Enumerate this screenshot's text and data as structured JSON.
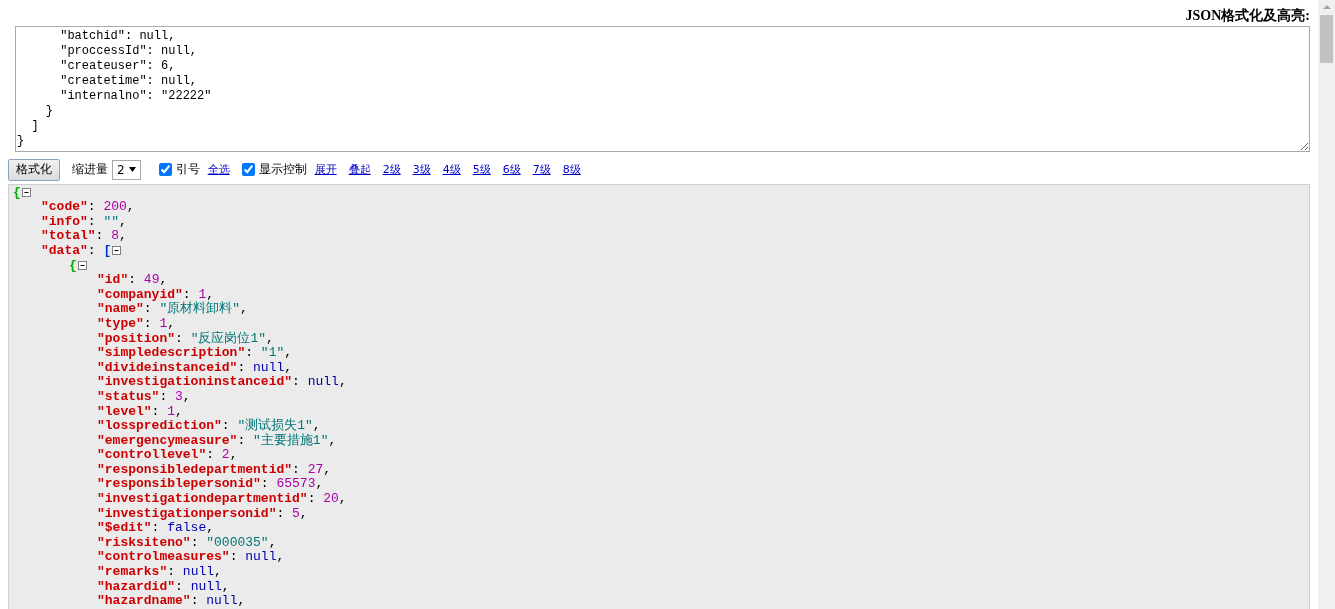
{
  "heading": "JSON格式化及高亮:",
  "input": {
    "lines": [
      "      \"batchid\": null,",
      "      \"proccessId\": null,",
      "      \"createuser\": 6,",
      "      \"createtime\": null,",
      "      \"internalno\": \"22222\"",
      "    }",
      "  ]",
      "}"
    ]
  },
  "toolbar": {
    "format_button": "格式化",
    "indent_label": "缩进量",
    "indent_value": "2",
    "quote": {
      "label": "引号",
      "checked": true
    },
    "select_all": "全选",
    "show_controls": {
      "label": "显示控制",
      "checked": true
    },
    "links": [
      "展开",
      "叠起",
      "2级",
      "3级",
      "4级",
      "5级",
      "6级",
      "7级",
      "8级"
    ]
  },
  "output": {
    "open": "{",
    "kind": "object",
    "expanded": true,
    "children": [
      {
        "key": "\"code\"",
        "sep": ": ",
        "value": "200",
        "kind": "number",
        "end": ","
      },
      {
        "key": "\"info\"",
        "sep": ": ",
        "value": "\"\"",
        "kind": "string",
        "end": ","
      },
      {
        "key": "\"total\"",
        "sep": ": ",
        "value": "8",
        "kind": "number",
        "end": ","
      },
      {
        "key": "\"data\"",
        "sep": ": ",
        "open": "[",
        "kind": "array",
        "expanded": true,
        "children": [
          {
            "open": "{",
            "kind": "object",
            "expanded": true,
            "children": [
              {
                "key": "\"id\"",
                "sep": ": ",
                "value": "49",
                "kind": "number",
                "end": ","
              },
              {
                "key": "\"companyid\"",
                "sep": ": ",
                "value": "1",
                "kind": "number",
                "end": ","
              },
              {
                "key": "\"name\"",
                "sep": ": ",
                "value": "\"原材料卸料\"",
                "kind": "string",
                "end": ","
              },
              {
                "key": "\"type\"",
                "sep": ": ",
                "value": "1",
                "kind": "number",
                "end": ","
              },
              {
                "key": "\"position\"",
                "sep": ": ",
                "value": "\"反应岗位1\"",
                "kind": "string",
                "end": ","
              },
              {
                "key": "\"simpledescription\"",
                "sep": ": ",
                "value": "\"1\"",
                "kind": "string",
                "end": ","
              },
              {
                "key": "\"divideinstanceid\"",
                "sep": ": ",
                "value": "null",
                "kind": "null",
                "end": ","
              },
              {
                "key": "\"investigationinstanceid\"",
                "sep": ": ",
                "value": "null",
                "kind": "null",
                "end": ","
              },
              {
                "key": "\"status\"",
                "sep": ": ",
                "value": "3",
                "kind": "number",
                "end": ","
              },
              {
                "key": "\"level\"",
                "sep": ": ",
                "value": "1",
                "kind": "number",
                "end": ","
              },
              {
                "key": "\"lossprediction\"",
                "sep": ": ",
                "value": "\"测试损失1\"",
                "kind": "string",
                "end": ","
              },
              {
                "key": "\"emergencymeasure\"",
                "sep": ": ",
                "value": "\"主要措施1\"",
                "kind": "string",
                "end": ","
              },
              {
                "key": "\"controllevel\"",
                "sep": ": ",
                "value": "2",
                "kind": "number",
                "end": ","
              },
              {
                "key": "\"responsibledepartmentid\"",
                "sep": ": ",
                "value": "27",
                "kind": "number",
                "end": ","
              },
              {
                "key": "\"responsiblepersonid\"",
                "sep": ": ",
                "value": "65573",
                "kind": "number",
                "end": ","
              },
              {
                "key": "\"investigationdepartmentid\"",
                "sep": ": ",
                "value": "20",
                "kind": "number",
                "end": ","
              },
              {
                "key": "\"investigationpersonid\"",
                "sep": ": ",
                "value": "5",
                "kind": "number",
                "end": ","
              },
              {
                "key": "\"$edit\"",
                "sep": ": ",
                "value": "false",
                "kind": "boolean",
                "end": ","
              },
              {
                "key": "\"risksiteno\"",
                "sep": ": ",
                "value": "\"000035\"",
                "kind": "string",
                "end": ","
              },
              {
                "key": "\"controlmeasures\"",
                "sep": ": ",
                "value": "null",
                "kind": "null",
                "end": ","
              },
              {
                "key": "\"remarks\"",
                "sep": ": ",
                "value": "null",
                "kind": "null",
                "end": ","
              },
              {
                "key": "\"hazardid\"",
                "sep": ": ",
                "value": "null",
                "kind": "null",
                "end": ","
              },
              {
                "key": "\"hazardname\"",
                "sep": ": ",
                "value": "null",
                "kind": "null",
                "end": ","
              }
            ]
          }
        ]
      }
    ]
  }
}
